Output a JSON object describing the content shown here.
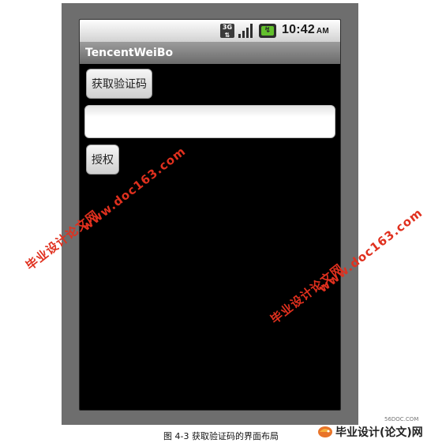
{
  "status_bar": {
    "network_badge": "3G",
    "time": "10:42",
    "ampm": "AM",
    "icons": [
      "3g-icon",
      "signal-icon",
      "battery-charging-icon"
    ]
  },
  "app": {
    "title": "TencentWeiBo",
    "get_code_button": "获取验证码",
    "code_input_value": "",
    "authorize_button": "授权"
  },
  "watermarks": {
    "site_name": "毕业设计论文网",
    "url": "www.doc163.com"
  },
  "caption": "图 4-3 获取验证码的界面布局",
  "footer_logo": {
    "site": "56DOC.COM",
    "name": "毕业设计(论文)网"
  },
  "colors": {
    "device_frame": "#6e6e6e",
    "screen_background": "#000000",
    "watermark": "#e0301e",
    "battery": "#62c02c"
  }
}
